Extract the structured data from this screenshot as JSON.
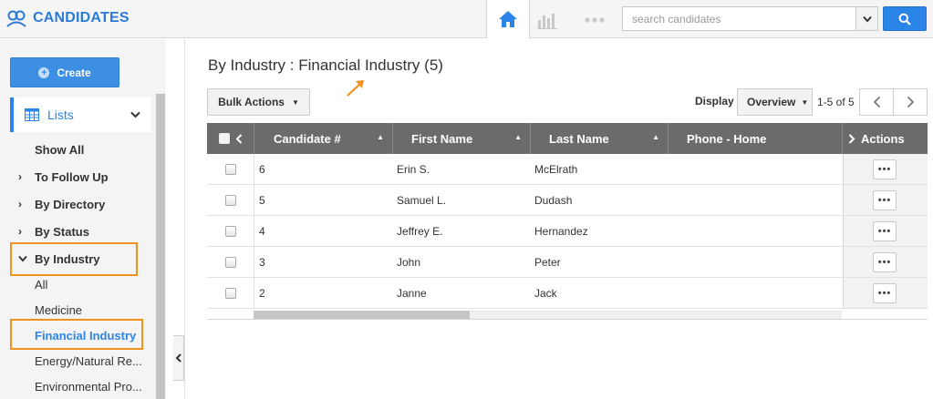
{
  "app": {
    "title": "CANDIDATES"
  },
  "search": {
    "placeholder": "search candidates"
  },
  "sidebar": {
    "create_label": "Create",
    "lists_label": "Lists",
    "items": [
      {
        "label": "Show All"
      },
      {
        "label": "To Follow Up"
      },
      {
        "label": "By Directory"
      },
      {
        "label": "By Status"
      },
      {
        "label": "By Industry"
      }
    ],
    "industry_sub": [
      {
        "label": "All"
      },
      {
        "label": "Medicine"
      },
      {
        "label": "Financial Industry"
      },
      {
        "label": "Energy/Natural Re..."
      },
      {
        "label": "Environmental Pro..."
      }
    ]
  },
  "main": {
    "title": "By Industry : Financial Industry (5)",
    "bulk_actions": "Bulk Actions",
    "display_label": "Display",
    "display_value": "Overview",
    "pager": "1-5 of 5"
  },
  "table": {
    "columns": [
      "Candidate #",
      "First Name",
      "Last Name",
      "Phone - Home",
      "Actions"
    ],
    "rows": [
      {
        "id": "6",
        "first": "Erin S.",
        "last": "McElrath",
        "phone": ""
      },
      {
        "id": "5",
        "first": "Samuel L.",
        "last": "Dudash",
        "phone": ""
      },
      {
        "id": "4",
        "first": "Jeffrey E.",
        "last": "Hernandez",
        "phone": ""
      },
      {
        "id": "3",
        "first": "John",
        "last": "Peter",
        "phone": ""
      },
      {
        "id": "2",
        "first": "Janne",
        "last": "Jack",
        "phone": ""
      }
    ],
    "action_label": "•••"
  },
  "colors": {
    "brand": "#2b7bd6",
    "accent": "#2b84e8",
    "highlight": "#f0921e",
    "table_header": "#6b6b6b"
  },
  "icons": [
    "candidates-logo-icon",
    "home-icon",
    "bar-chart-icon",
    "more-dots-icon",
    "chevron-down-icon",
    "search-icon",
    "plus-circle-icon",
    "grid-list-icon",
    "chevron-left-icon",
    "chevron-right-icon",
    "sort-up-icon",
    "arrow-pointer-icon"
  ]
}
